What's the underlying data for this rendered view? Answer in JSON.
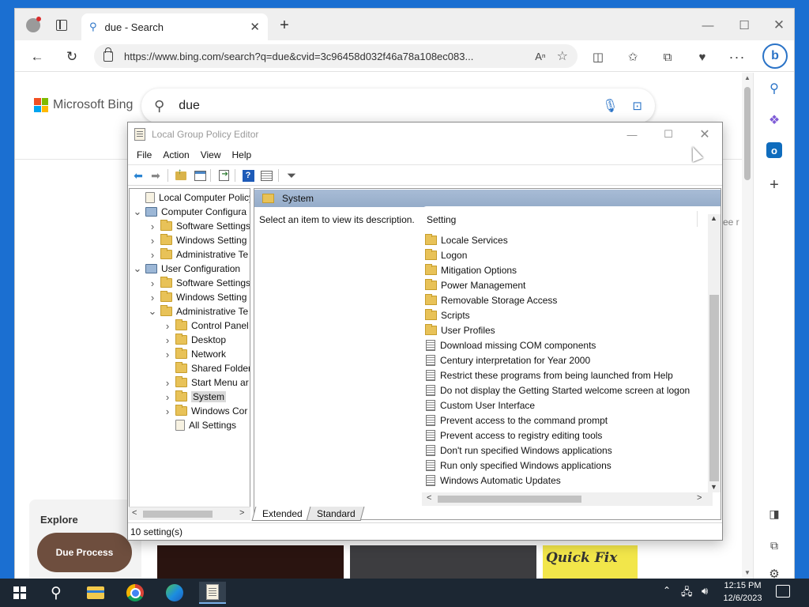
{
  "browser": {
    "tab_title": "due - Search",
    "url": "https://www.bing.com/search?q=due&cvid=3c96458d032f46a78a108ec083...",
    "read_aloud_label": "A",
    "window_controls": [
      "minimize",
      "maximize",
      "close"
    ]
  },
  "bing": {
    "logo_text": "Microsoft Bing",
    "query": "due",
    "explore_label": "Explore",
    "due_process_label": "Due Process",
    "see_more_fragment": "ee r",
    "quick_fix_label": "Quick Fix"
  },
  "gpedit": {
    "title": "Local Group Policy Editor",
    "menu": [
      "File",
      "Action",
      "View",
      "Help"
    ],
    "tree": [
      {
        "label": "Local Computer Policy",
        "level": 0,
        "expander": "",
        "icon": "doc"
      },
      {
        "label": "Computer Configura",
        "level": 0,
        "expander": "v",
        "icon": "pc"
      },
      {
        "label": "Software Settings",
        "level": 1,
        "expander": ">",
        "icon": "folder"
      },
      {
        "label": "Windows Setting",
        "level": 1,
        "expander": ">",
        "icon": "folder"
      },
      {
        "label": "Administrative Te",
        "level": 1,
        "expander": ">",
        "icon": "folder"
      },
      {
        "label": "User Configuration",
        "level": 0,
        "expander": "v",
        "icon": "pc"
      },
      {
        "label": "Software Settings",
        "level": 1,
        "expander": ">",
        "icon": "folder"
      },
      {
        "label": "Windows Setting",
        "level": 1,
        "expander": ">",
        "icon": "folder"
      },
      {
        "label": "Administrative Te",
        "level": 1,
        "expander": "v",
        "icon": "folder"
      },
      {
        "label": "Control Panel",
        "level": 2,
        "expander": ">",
        "icon": "folder"
      },
      {
        "label": "Desktop",
        "level": 2,
        "expander": ">",
        "icon": "folder"
      },
      {
        "label": "Network",
        "level": 2,
        "expander": ">",
        "icon": "folder"
      },
      {
        "label": "Shared Folder",
        "level": 2,
        "expander": "",
        "icon": "folder"
      },
      {
        "label": "Start Menu ar",
        "level": 2,
        "expander": ">",
        "icon": "folder"
      },
      {
        "label": "System",
        "level": 2,
        "expander": ">",
        "icon": "folder",
        "selected": true
      },
      {
        "label": "Windows Cor",
        "level": 2,
        "expander": ">",
        "icon": "folder"
      },
      {
        "label": "All Settings",
        "level": 2,
        "expander": "",
        "icon": "doc"
      }
    ],
    "right_header": "System",
    "description": "Select an item to view its description.",
    "list_header": "Setting",
    "settings": [
      {
        "label": "Locale Services",
        "type": "folder"
      },
      {
        "label": "Logon",
        "type": "folder"
      },
      {
        "label": "Mitigation Options",
        "type": "folder"
      },
      {
        "label": "Power Management",
        "type": "folder"
      },
      {
        "label": "Removable Storage Access",
        "type": "folder"
      },
      {
        "label": "Scripts",
        "type": "folder"
      },
      {
        "label": "User Profiles",
        "type": "folder"
      },
      {
        "label": "Download missing COM components",
        "type": "policy"
      },
      {
        "label": "Century interpretation for Year 2000",
        "type": "policy"
      },
      {
        "label": "Restrict these programs from being launched from Help",
        "type": "policy"
      },
      {
        "label": "Do not display the Getting Started welcome screen at logon",
        "type": "policy"
      },
      {
        "label": "Custom User Interface",
        "type": "policy"
      },
      {
        "label": "Prevent access to the command prompt",
        "type": "policy"
      },
      {
        "label": "Prevent access to registry editing tools",
        "type": "policy"
      },
      {
        "label": "Don't run specified Windows applications",
        "type": "policy"
      },
      {
        "label": "Run only specified Windows applications",
        "type": "policy"
      },
      {
        "label": "Windows Automatic Updates",
        "type": "policy"
      }
    ],
    "tabs": [
      "Extended",
      "Standard"
    ],
    "status": "10 setting(s)"
  },
  "taskbar": {
    "time": "12:15 PM",
    "date": "12/6/2023"
  }
}
